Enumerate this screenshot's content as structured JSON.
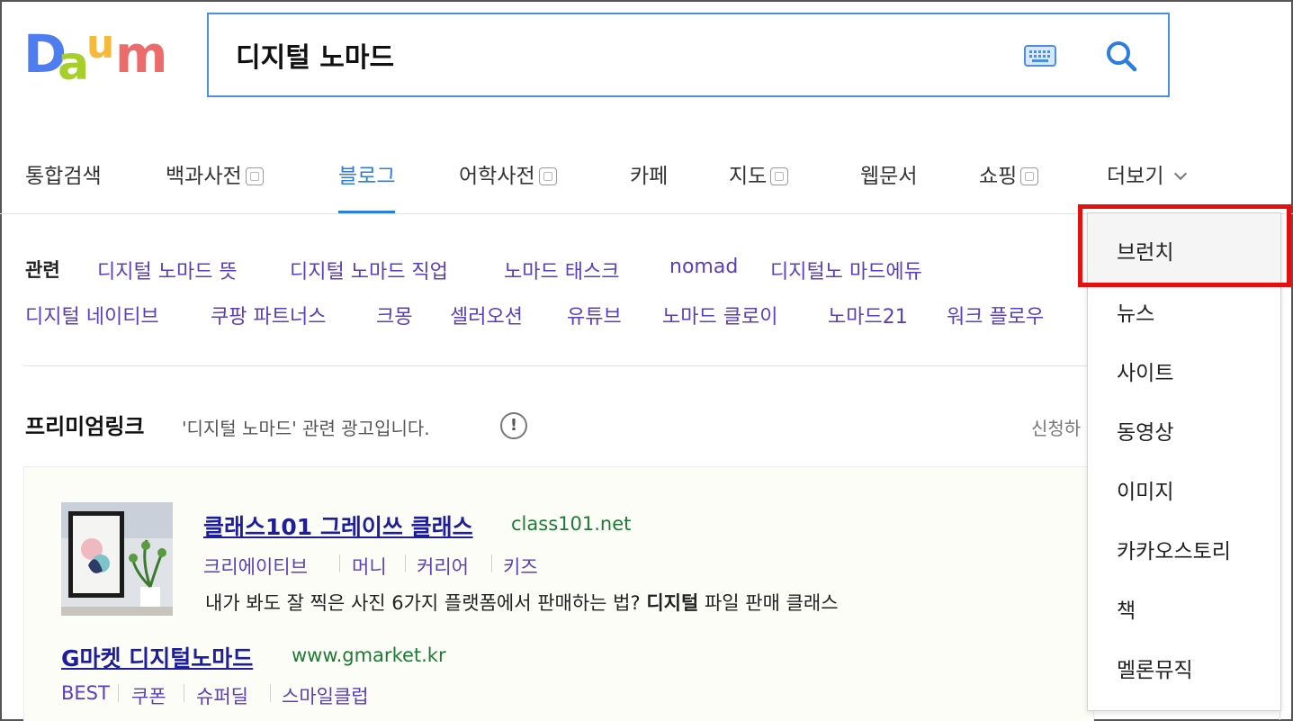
{
  "search": {
    "query": "디지털 노마드"
  },
  "logo": {
    "text": "Daum"
  },
  "tabs": [
    {
      "label": "통합검색",
      "new_window": false,
      "active": false
    },
    {
      "label": "백과사전",
      "new_window": true,
      "active": false
    },
    {
      "label": "블로그",
      "new_window": false,
      "active": true
    },
    {
      "label": "어학사전",
      "new_window": true,
      "active": false
    },
    {
      "label": "카페",
      "new_window": false,
      "active": false
    },
    {
      "label": "지도",
      "new_window": true,
      "active": false
    },
    {
      "label": "웹문서",
      "new_window": false,
      "active": false
    },
    {
      "label": "쇼핑",
      "new_window": true,
      "active": false
    },
    {
      "label": "더보기",
      "new_window": false,
      "active": false
    }
  ],
  "related": {
    "label": "관련",
    "links": [
      "디지털 노마드 뜻",
      "디지털 노마드 직업",
      "노마드 태스크",
      "nomad",
      "디지털노 마드에듀",
      "디지털 네이티브",
      "쿠팡 파트너스",
      "크몽",
      "셀러오션",
      "유튜브",
      "노마드 클로이",
      "노마드21",
      "워크 플로우"
    ]
  },
  "premium": {
    "title": "프리미엄링크",
    "description": "'디지털 노마드' 관련 광고입니다.",
    "info_icon": "!",
    "apply": "신청하"
  },
  "ads": [
    {
      "title": "클래스101 그레이쓰 클래스",
      "url": "class101.net",
      "sublinks": [
        "크리에이티브",
        "머니",
        "커리어",
        "키즈"
      ],
      "desc_before": "내가 봐도 잘 찍은 사진 6가지 플랫폼에서 판매하는 법? ",
      "desc_bold": "디지털",
      "desc_after": " 파일 판매 클래스"
    },
    {
      "title": "G마켓 디지털노마드",
      "url": "www.gmarket.kr",
      "sublinks": [
        "BEST",
        "쿠폰",
        "슈퍼딜",
        "스마일클럽"
      ]
    }
  ],
  "more_menu": {
    "items": [
      "브런치",
      "뉴스",
      "사이트",
      "동영상",
      "이미지",
      "카카오스토리",
      "책",
      "멜론뮤직"
    ],
    "highlighted": "브런치",
    "highlight_color": "#e41010"
  },
  "colors": {
    "accent": "#2a7de1",
    "link": "#5a3fc0",
    "title_link": "#1e1e9c",
    "url": "#1f7a35"
  }
}
